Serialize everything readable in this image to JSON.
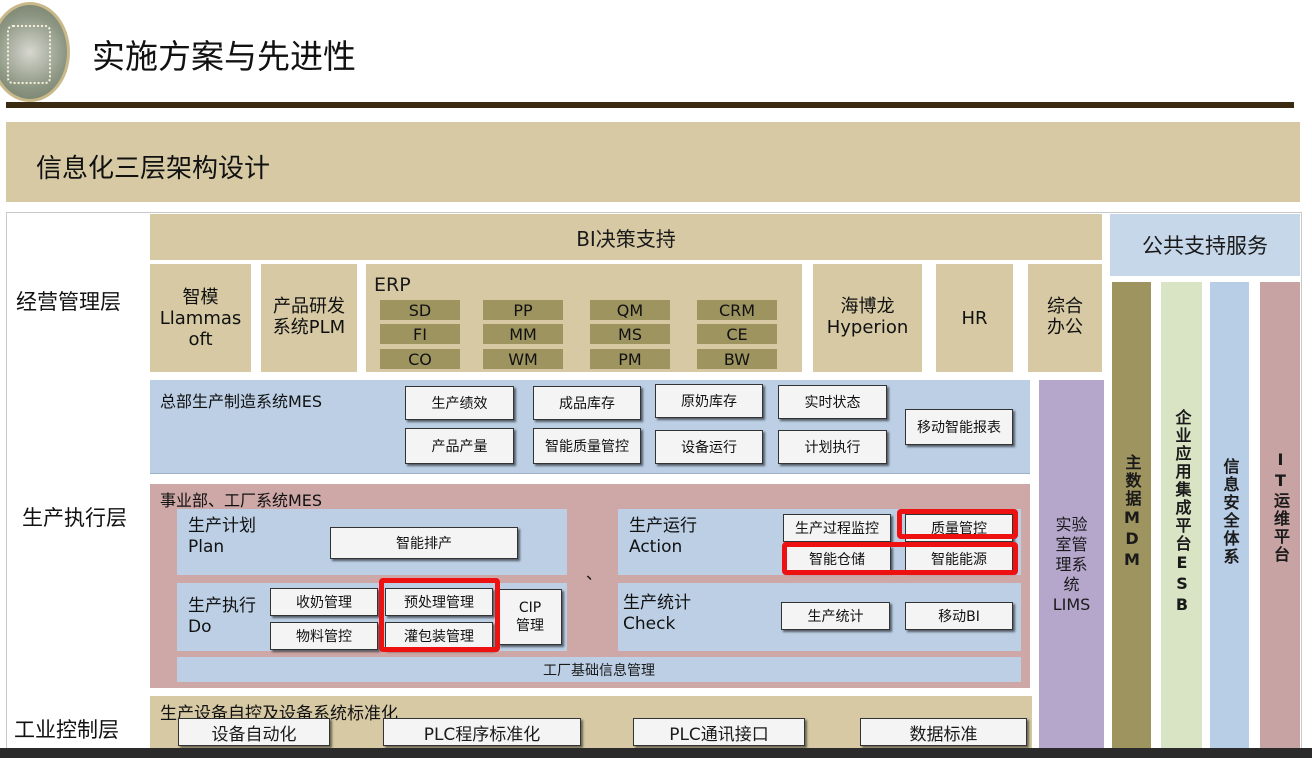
{
  "header": {
    "title": "实施方案与先进性",
    "section_title": "信息化三层架构设计"
  },
  "layers": {
    "business": "经营管理层",
    "execution": "生产执行层",
    "control": "工业控制层"
  },
  "bi_label": "BI决策支持",
  "business_boxes": {
    "llamasoft": "智模\nLlammas\noft",
    "plm": "产品研发\n系统PLM",
    "erp_title": "ERP",
    "erp_modules": [
      "SD",
      "PP",
      "QM",
      "CRM",
      "FI",
      "MM",
      "MS",
      "CE",
      "CO",
      "WM",
      "PM",
      "BW"
    ],
    "hyperion": "海博龙\nHyperion",
    "hr": "HR",
    "office": "综合\n办公"
  },
  "hq_mes": {
    "label": "总部生产制造系统MES",
    "buttons": [
      "生产绩效",
      "成品库存",
      "原奶库存",
      "实时状态",
      "产品产量",
      "智能质量管控",
      "设备运行",
      "计划执行",
      "移动智能报表"
    ]
  },
  "plant_mes": {
    "label": "事业部、工厂系统MES",
    "plan_label": "生产计划\nPlan",
    "plan_button": "智能排产",
    "action_label": "生产运行\nAction",
    "action_buttons": [
      "生产过程监控",
      "质量管控",
      "智能仓储",
      "智能能源"
    ],
    "do_label": "生产执行\nDo",
    "do_buttons": [
      "收奶管理",
      "预处理管理",
      "物料管控",
      "灌包装管理",
      "CIP\n管理"
    ],
    "check_label": "生产统计\nCheck",
    "check_buttons": [
      "生产统计",
      "移动BI"
    ],
    "base_info": "工厂基础信息管理",
    "separator": "、"
  },
  "control_layer": {
    "label": "生产设备自控及设备系统标准化",
    "buttons": [
      "设备自动化",
      "PLC程序标准化",
      "PLC通讯接口",
      "数据标准"
    ]
  },
  "lims": "实验\n室管\n理系\n统\nLIMS",
  "public_support": {
    "title": "公共支持服务",
    "columns": [
      "主数据MDM",
      "企业应用集成平台ESB",
      "信息安全体系",
      "IT运维平台"
    ]
  },
  "colors": {
    "tan": "#d6c9a4",
    "blue_panel": "#bccfe5",
    "rose_panel": "#cea7a7",
    "lims": "#b5a6cc",
    "olive": "#9e9460",
    "highlight": "#ee1111"
  }
}
